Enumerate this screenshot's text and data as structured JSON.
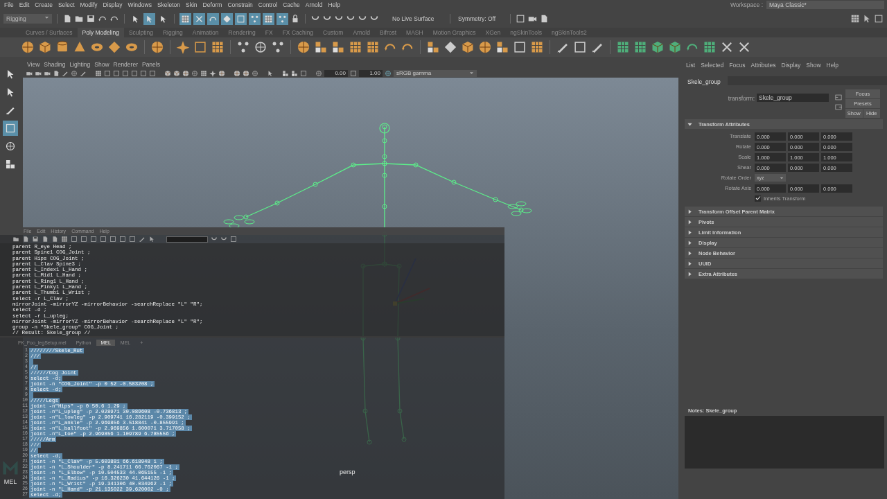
{
  "menubar": {
    "items": [
      "File",
      "Edit",
      "Create",
      "Select",
      "Modify",
      "Display",
      "Windows",
      "Skeleton",
      "Skin",
      "Deform",
      "Constrain",
      "Control",
      "Cache",
      "Arnold",
      "Help"
    ],
    "workspace_label": "Workspace :",
    "workspace": "Maya Classic*"
  },
  "status_line": {
    "mode": "Rigging",
    "tool_buttons": [
      {
        "on": false
      },
      {
        "on": true
      },
      {
        "on": false
      },
      {
        "on": true
      },
      {
        "on": true
      },
      {
        "on": true
      },
      {
        "on": true
      },
      {
        "on": true
      },
      {
        "on": true
      },
      {
        "on": true
      },
      {
        "on": true
      }
    ],
    "live_surface": "No Live Surface",
    "symmetry": "Symmetry: Off"
  },
  "shelf": {
    "tabs": [
      {
        "label": "Curves / Surfaces",
        "selected": false
      },
      {
        "label": "Poly Modeling",
        "selected": true
      },
      {
        "label": "Sculpting",
        "selected": false
      },
      {
        "label": "Rigging",
        "selected": false
      },
      {
        "label": "Animation",
        "selected": false
      },
      {
        "label": "Rendering",
        "selected": false
      },
      {
        "label": "FX",
        "selected": false
      },
      {
        "label": "FX Caching",
        "selected": false
      },
      {
        "label": "Custom",
        "selected": false
      },
      {
        "label": "Arnold",
        "selected": false
      },
      {
        "label": "Bifrost",
        "selected": false
      },
      {
        "label": "MASH",
        "selected": false
      },
      {
        "label": "Motion Graphics",
        "selected": false
      },
      {
        "label": "XGen",
        "selected": false
      },
      {
        "label": "ngSkinTools",
        "selected": false
      },
      {
        "label": "ngSkinTools2",
        "selected": false
      }
    ]
  },
  "toolbox": {
    "tools": [
      {
        "selected": false
      },
      {
        "selected": false
      },
      {
        "selected": false
      },
      {
        "selected": true
      },
      {
        "selected": false
      },
      {
        "selected": false
      }
    ],
    "command_language": "MEL"
  },
  "viewport": {
    "menus": [
      "View",
      "Shading",
      "Lighting",
      "Show",
      "Renderer",
      "Panels"
    ],
    "exposure": "0.00",
    "gamma": "1.00",
    "color_space": "sRGB gamma",
    "camera": "persp"
  },
  "script_editor": {
    "menus": [
      "File",
      "Edit",
      "History",
      "Command",
      "Help"
    ],
    "history": [
      "parent R_eye Head ;",
      "parent Spine1 COG_Joint ;",
      "parent Hips COG_Joint ;",
      "parent L_Clav Spine3 ;",
      "parent L_Index1 L_Hand ;",
      "parent L_Mid1 L_Hand ;",
      "parent L_Ring1 L_Hand ;",
      "parent L_Pinky1 L_Hand ;",
      "parent L_Thumb1 L_Wrist ;",
      "select -r L_Clav ;",
      "mirrorJoint -mirrorYZ -mirrorBehavior -searchReplace \"L\" \"R\";",
      "select -d ;",
      "select -r L_upleg;",
      "mirrorJoint -mirrorYZ -mirrorBehavior -searchReplace \"L\" \"R\";",
      "group -n \"Skele_group\" COG_Joint ;",
      "// Result: Skele_group //"
    ],
    "tabs": [
      {
        "label": "FK_Foo_legSetup.mel",
        "selected": false
      },
      {
        "label": "Python",
        "selected": false
      },
      {
        "label": "MEL",
        "selected": true
      },
      {
        "label": "MEL",
        "selected": false
      },
      {
        "label": "+",
        "selected": false
      }
    ],
    "lines": [
      {
        "number": "1",
        "code": "////////Skele_Rut",
        "selected": true
      },
      {
        "number": "2",
        "code": "///",
        "selected": true
      },
      {
        "number": "3",
        "selected": true
      },
      {
        "number": "4",
        "code": "//",
        "selected": true
      },
      {
        "number": "5",
        "code": "//////Cog Joint",
        "selected": true
      },
      {
        "number": "6",
        "code": "select -d;",
        "selected": true
      },
      {
        "number": "7",
        "code": "joint -n \"COG_Joint\" -p 0 52 -0.583208 ;",
        "selected": true
      },
      {
        "number": "8",
        "code": "select -d;",
        "selected": true
      },
      {
        "number": "9",
        "selected": true
      },
      {
        "number": "10",
        "code": "/////Legs",
        "selected": true
      },
      {
        "number": "11",
        "code": "joint -n\"Hips\" -p 0 50.6 1.29 ;",
        "selected": true
      },
      {
        "number": "12",
        "code": "joint -n\"L_upleg\" -p 2.028971 30.089608 -0.736813 ;",
        "selected": true
      },
      {
        "number": "13",
        "code": "joint -n\"L_lowleg\" -p 2.909741 16.282119 -0.399152 ;",
        "selected": true
      },
      {
        "number": "14",
        "code": "joint -n\"L_ankle\" -p 2.969856 3.518841 -0.855991 ;",
        "selected": true
      },
      {
        "number": "15",
        "code": "joint -n\"L_ballfoot\" -p 2.969856 1.600071 3.717058 ;",
        "selected": true
      },
      {
        "number": "16",
        "code": "joint -n\"L_toe\" -p 2.969856 1.109789 6.785556 ;",
        "selected": true
      },
      {
        "number": "17",
        "code": "/////Arm",
        "selected": true
      },
      {
        "number": "18",
        "code": "///",
        "selected": true
      },
      {
        "number": "19",
        "code": "//",
        "selected": true
      },
      {
        "number": "20",
        "code": "select -d;",
        "selected": true
      },
      {
        "number": "21",
        "code": "joint -n \"L_Clav\" -p 5.603881 66.618948 1 ;",
        "selected": true
      },
      {
        "number": "22",
        "code": "joint -n \"L_Shoulder\" -p 8.241711 66.762067 -1 ;",
        "selected": true
      },
      {
        "number": "23",
        "code": "joint -n \"L_Elbow\" -p 10.504533 44.065155 -1 ;",
        "selected": true
      },
      {
        "number": "24",
        "code": "joint -n \"L_Radius\" -p 16.326230 41.644126 -1 ;",
        "selected": true
      },
      {
        "number": "25",
        "code": "joint -n \"L_Wrist\" -p 19.341306 40.034962 -1 ;",
        "selected": true
      },
      {
        "number": "26",
        "code": "joint -n \"L_Hand\" -p 21.135022 39.620002 -0 ;",
        "selected": true
      },
      {
        "number": "27",
        "code": "select -d;",
        "selected": true
      }
    ]
  },
  "attribute_editor": {
    "menus": [
      "List",
      "Selected",
      "Focus",
      "Attributes",
      "Display",
      "Show",
      "Help"
    ],
    "node_tab": "Skele_group",
    "node_type_label": "transform:",
    "node_name": "Skele_group",
    "buttons": [
      "Focus",
      "Presets",
      "Show",
      "Hide"
    ],
    "sections": [
      {
        "title": "Transform Attributes",
        "expanded": true
      },
      {
        "title": "Transform Offset Parent Matrix",
        "expanded": false
      },
      {
        "title": "Pivots",
        "expanded": false
      },
      {
        "title": "Limit Information",
        "expanded": false
      },
      {
        "title": "Display",
        "expanded": false
      },
      {
        "title": "Node Behavior",
        "expanded": false
      },
      {
        "title": "UUID",
        "expanded": false
      },
      {
        "title": "Extra Attributes",
        "expanded": false
      }
    ],
    "transform_attributes": {
      "rows": [
        {
          "kind": "vector",
          "label": "Translate",
          "values": [
            "0.000",
            "0.000",
            "0.000"
          ]
        },
        {
          "kind": "vector",
          "label": "Rotate",
          "values": [
            "0.000",
            "0.000",
            "0.000"
          ]
        },
        {
          "kind": "vector",
          "label": "Scale",
          "values": [
            "1.000",
            "1.000",
            "1.000"
          ]
        },
        {
          "kind": "vector",
          "label": "Shear",
          "values": [
            "0.000",
            "0.000",
            "0.000"
          ]
        },
        {
          "kind": "dropdown",
          "label": "Rotate Order",
          "value": "xyz"
        },
        {
          "kind": "vector",
          "label": "Rotate Axis",
          "values": [
            "0.000",
            "0.000",
            "0.000"
          ]
        }
      ],
      "inherits_transform": {
        "label": "Inherits Transform",
        "checked": true
      }
    },
    "notes_label": "Notes: Skele_group"
  }
}
